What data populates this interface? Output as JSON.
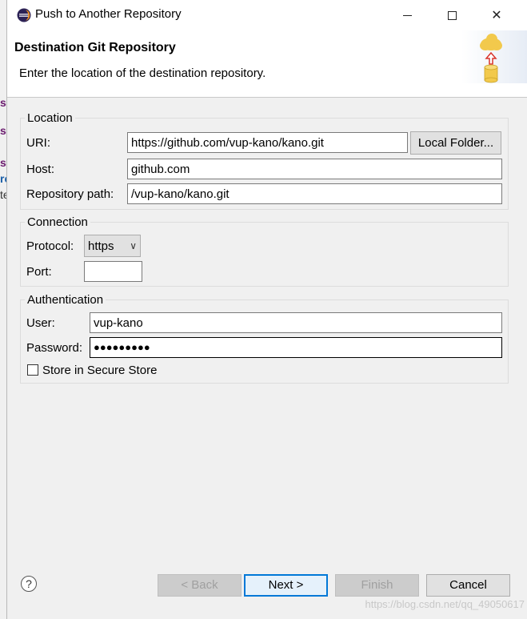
{
  "window": {
    "title": "Push to Another Repository",
    "minimize_icon": "minimize-icon",
    "maximize_icon": "maximize-icon",
    "close_icon": "close-icon",
    "close_glyph": "✕"
  },
  "header": {
    "title": "Destination Git Repository",
    "description": "Enter the location of the destination repository."
  },
  "location": {
    "legend": "Location",
    "uri_label": "URI:",
    "uri_value": "https://github.com/vup-kano/kano.git",
    "local_folder_button": "Local Folder...",
    "host_label": "Host:",
    "host_value": "github.com",
    "repo_path_label": "Repository path:",
    "repo_path_value": "/vup-kano/kano.git"
  },
  "connection": {
    "legend": "Connection",
    "protocol_label": "Protocol:",
    "protocol_value": "https",
    "protocol_chevron": "∨",
    "port_label": "Port:",
    "port_value": ""
  },
  "authentication": {
    "legend": "Authentication",
    "user_label": "User:",
    "user_value": "vup-kano",
    "password_label": "Password:",
    "password_value": "●●●●●●●●●",
    "store_label": "Store in Secure Store",
    "store_checked": false
  },
  "footer": {
    "help_glyph": "?",
    "back_button": "< Back",
    "next_button": "Next >",
    "finish_button": "Finish",
    "cancel_button": "Cancel",
    "watermark": "https://blog.csdn.net/qq_49050617"
  },
  "background": {
    "glyph_1": "s",
    "glyph_2": "st",
    "glyph_3": "rc",
    "glyph_4": "te"
  },
  "colors": {
    "accent": "#0078d7",
    "eclipse_purple": "#2c2255",
    "cloud": "#f2c94c",
    "arrow": "#d9342b"
  }
}
